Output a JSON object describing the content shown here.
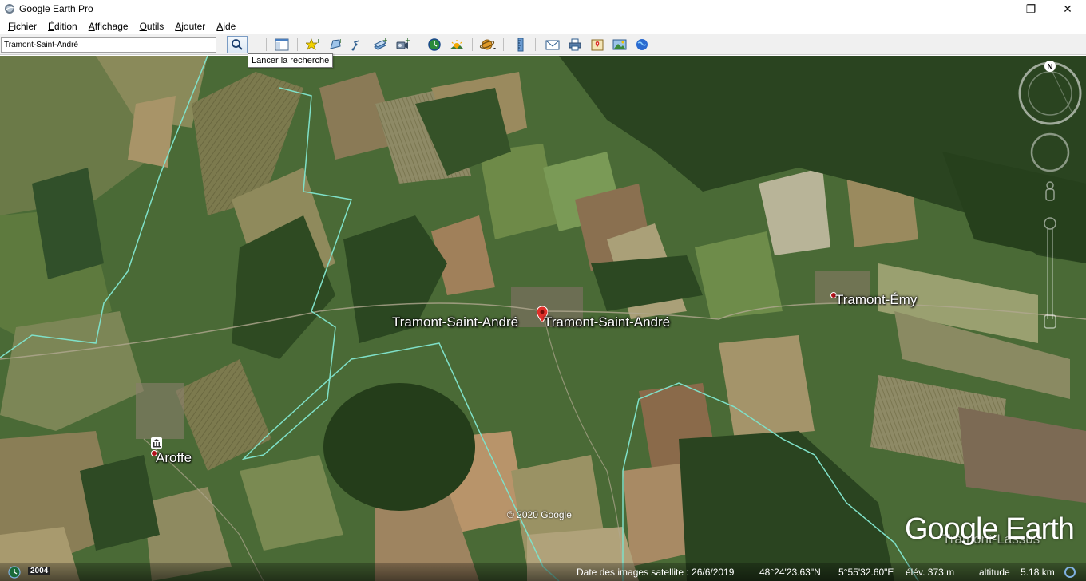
{
  "window": {
    "title": "Google Earth Pro"
  },
  "menu": [
    "Fichier",
    "Édition",
    "Affichage",
    "Outils",
    "Ajouter",
    "Aide"
  ],
  "search": {
    "value": "Tramont-Saint-André",
    "tooltip": "Lancer la recherche"
  },
  "toolbar": {
    "icons": [
      "sidebar-icon",
      "placemark-icon",
      "polygon-icon",
      "path-icon",
      "image-overlay-icon",
      "tour-icon",
      "historical-imagery-icon",
      "sun-icon",
      "planet-icon",
      "ruler-icon",
      "email-icon",
      "print-icon",
      "google-maps-icon",
      "save-image-icon",
      "earth-gallery-icon"
    ]
  },
  "map": {
    "places": [
      {
        "name": "Tramont-Saint-André"
      },
      {
        "name": "Tramont-Saint-André"
      },
      {
        "name": "Tramont-Émy"
      },
      {
        "name": "Aroffe"
      },
      {
        "name": "Tramont-Lassus"
      }
    ],
    "copyright": "© 2020 Google",
    "logo": "Google Earth",
    "compass_label": "N"
  },
  "status": {
    "year": "2004",
    "imagery_date": "Date des images satellite : 26/6/2019",
    "lat": "48°24'23.63\"N",
    "lon": "5°55'32.60\"E",
    "elev": "élév.  373 m",
    "altitude": "altitude    5.18 km"
  },
  "colors": {
    "boundary": "#7fe0c8",
    "marker": "#e0302a",
    "forest": "#2d4a22"
  }
}
